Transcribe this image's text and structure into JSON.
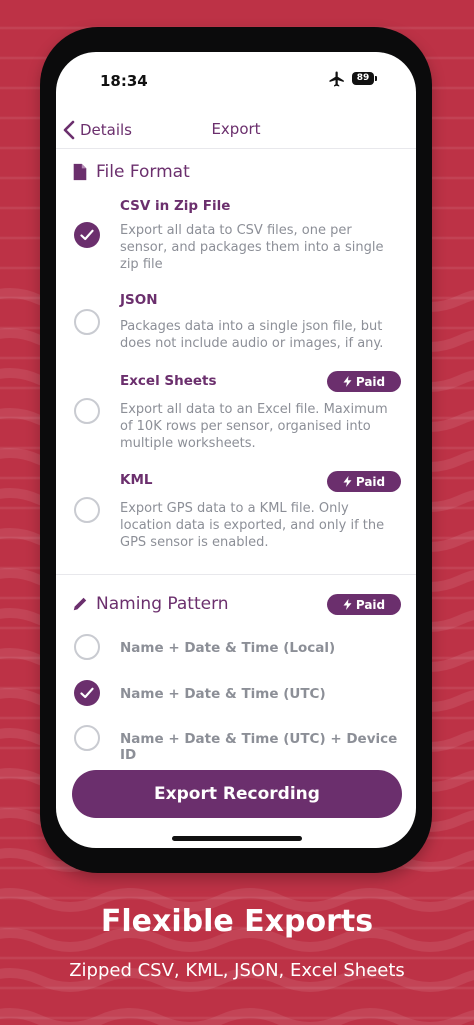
{
  "status_bar": {
    "time": "18:34",
    "battery": "89"
  },
  "nav": {
    "back_label": "Details",
    "title": "Export"
  },
  "file_format": {
    "heading": "File Format",
    "options": [
      {
        "title": "CSV in Zip File",
        "description": "Export all data to CSV files, one per sensor, and packages them into a single zip file",
        "checked": true,
        "paid": false
      },
      {
        "title": "JSON",
        "description": "Packages data into a single json file, but does not include audio or images, if any.",
        "checked": false,
        "paid": false
      },
      {
        "title": "Excel Sheets",
        "description": "Export all data to an Excel file. Maximum of 10K rows per sensor, organised into multiple worksheets.",
        "checked": false,
        "paid": true
      },
      {
        "title": "KML",
        "description": "Export GPS data to a KML file. Only location data is exported, and only if the GPS sensor is enabled.",
        "checked": false,
        "paid": true
      }
    ]
  },
  "paid_label": "Paid",
  "naming_pattern": {
    "heading": "Naming Pattern",
    "paid": true,
    "options": [
      {
        "label": "Name + Date & Time (Local)",
        "checked": false
      },
      {
        "label": "Name + Date & Time (UTC)",
        "checked": true
      },
      {
        "label": "Name + Date & Time (UTC) + Device ID",
        "checked": false
      }
    ]
  },
  "export_button": "Export Recording",
  "promo": {
    "headline": "Flexible Exports",
    "subline": "Zipped CSV, KML, JSON, Excel Sheets"
  },
  "colors": {
    "accent": "#6b2f6d",
    "background": "#bd3246",
    "muted_text": "#8c8f97"
  },
  "icons": [
    "airplane-icon",
    "battery-icon",
    "chevron-left-icon",
    "document-icon",
    "pencil-icon",
    "bolt-icon",
    "checkmark-icon"
  ]
}
